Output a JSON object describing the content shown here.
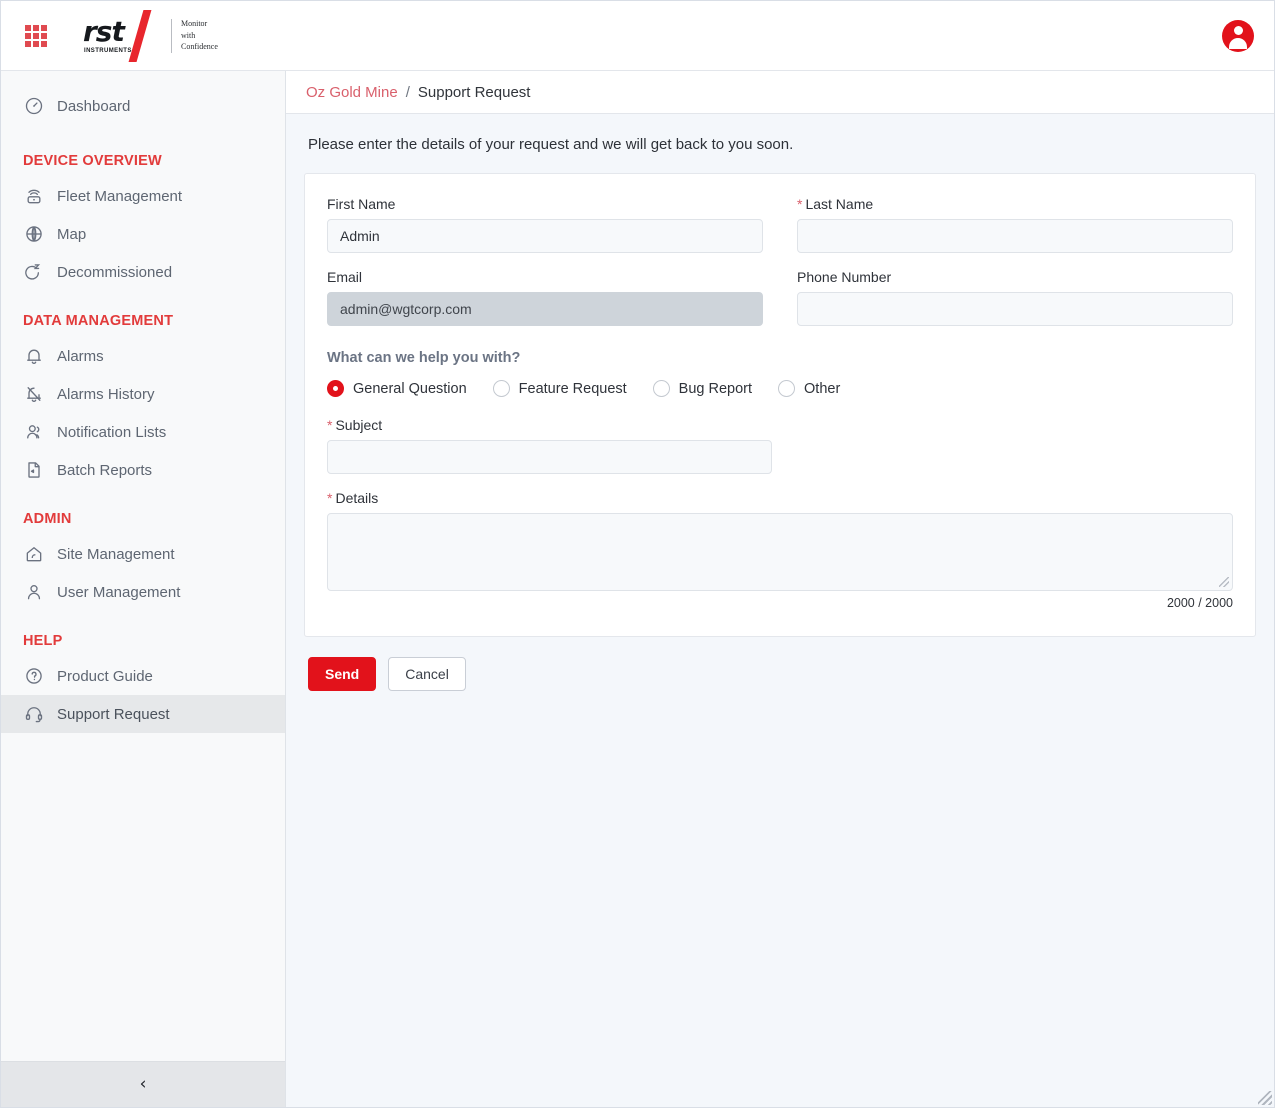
{
  "header": {
    "apps_icon": "apps-grid-icon",
    "logo": {
      "wordmark": "rst",
      "subtext": "INSTRUMENTS",
      "tagline_line1": "Monitor",
      "tagline_line2": "with",
      "tagline_line3": "Confidence"
    },
    "avatar_icon": "user-avatar-icon"
  },
  "sidebar": {
    "dashboard": {
      "label": "Dashboard",
      "icon": "gauge-icon"
    },
    "sections": [
      {
        "title": "DEVICE OVERVIEW",
        "items": [
          {
            "label": "Fleet Management",
            "icon": "router-icon",
            "active": false
          },
          {
            "label": "Map",
            "icon": "globe-icon",
            "active": false
          },
          {
            "label": "Decommissioned",
            "icon": "sleep-rotate-icon",
            "active": false
          }
        ]
      },
      {
        "title": "DATA MANAGEMENT",
        "items": [
          {
            "label": "Alarms",
            "icon": "bell-icon",
            "active": false
          },
          {
            "label": "Alarms History",
            "icon": "bell-off-icon",
            "active": false
          },
          {
            "label": "Notification Lists",
            "icon": "users-icon",
            "active": false
          },
          {
            "label": "Batch Reports",
            "icon": "file-report-icon",
            "active": false
          }
        ]
      },
      {
        "title": "ADMIN",
        "items": [
          {
            "label": "Site Management",
            "icon": "home-signal-icon",
            "active": false
          },
          {
            "label": "User Management",
            "icon": "user-icon",
            "active": false
          }
        ]
      },
      {
        "title": "HELP",
        "items": [
          {
            "label": "Product Guide",
            "icon": "question-circle-icon",
            "active": false
          },
          {
            "label": "Support Request",
            "icon": "headset-icon",
            "active": true
          }
        ]
      }
    ],
    "collapse_icon": "chevron-left-icon"
  },
  "breadcrumb": {
    "site": "Oz Gold Mine",
    "separator": "/",
    "current": "Support Request"
  },
  "main": {
    "intro": "Please enter the details of your request and we will get back to you soon.",
    "form": {
      "first_name": {
        "label": "First Name",
        "value": "Admin",
        "required": false
      },
      "last_name": {
        "label": "Last Name",
        "value": "",
        "required": true,
        "required_mark": "*"
      },
      "email": {
        "label": "Email",
        "value": "admin@wgtcorp.com",
        "required": false,
        "disabled": true
      },
      "phone": {
        "label": "Phone Number",
        "value": "",
        "required": false
      },
      "help_group_label": "What can we help you with?",
      "help_options": [
        {
          "label": "General Question",
          "selected": true
        },
        {
          "label": "Feature Request",
          "selected": false
        },
        {
          "label": "Bug Report",
          "selected": false
        },
        {
          "label": "Other",
          "selected": false
        }
      ],
      "subject": {
        "label": "Subject",
        "value": "",
        "required": true,
        "required_mark": "*"
      },
      "details": {
        "label": "Details",
        "value": "",
        "required": true,
        "required_mark": "*"
      },
      "counter": "2000 / 2000"
    },
    "buttons": {
      "send": "Send",
      "cancel": "Cancel"
    }
  },
  "colors": {
    "brand_red": "#e2121b",
    "section_red": "#e23b3b",
    "link_red": "#d9606c",
    "sidebar_bg": "#f8f9fa",
    "content_bg": "#f4f7fb",
    "input_bg": "#f7f9fb",
    "input_disabled_bg": "#ced4da"
  }
}
